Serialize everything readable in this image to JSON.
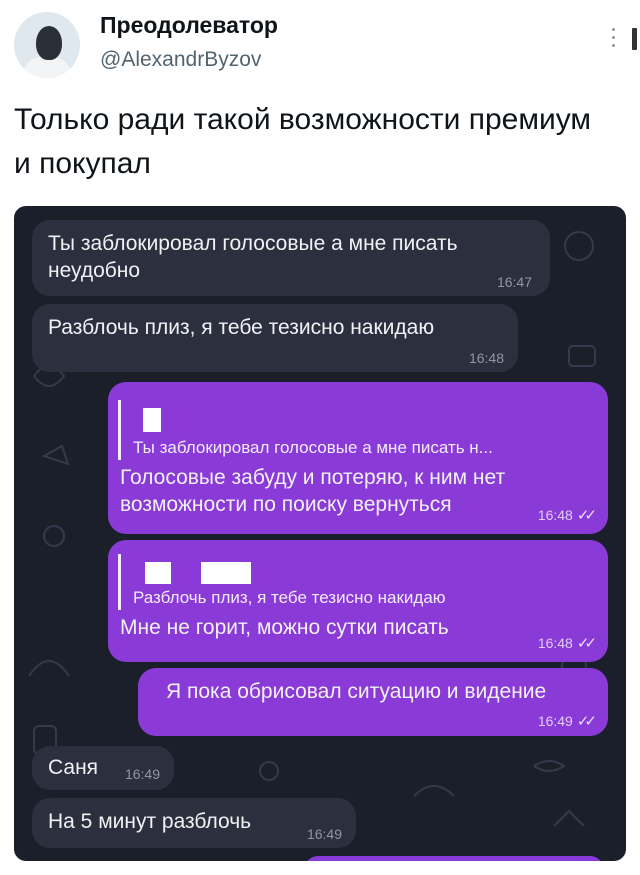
{
  "tweet": {
    "display_name": "Преодолеватор",
    "handle": "@AlexandrByzov",
    "text": "Только ради такой возможности премиум и покупал",
    "more_icon": "vertical-dots-icon"
  },
  "chat": {
    "background_color": "#1b1f2a",
    "incoming_color": "#2b2f3e",
    "outgoing_color": "#8a3ad6",
    "messages": [
      {
        "direction": "in",
        "text": "Ты заблокировал голосовые а мне писать\nнеудобно",
        "time": "16:47"
      },
      {
        "direction": "in",
        "text": "Разблочь плиз,  я тебе тезисно накидаю",
        "time": "16:48"
      },
      {
        "direction": "out",
        "reply_to": "Ты заблокировал голосовые а мне писать н...",
        "text": "Голосовые забуду и потеряю, к ним нет\nвозможности по поиску вернуться",
        "time": "16:48",
        "status": "read"
      },
      {
        "direction": "out",
        "reply_to": "Разблочь плиз,  я тебе тезисно накидаю",
        "text": "Мне не горит, можно сутки писать",
        "time": "16:48",
        "status": "read"
      },
      {
        "direction": "out",
        "text": "Я пока обрисовал ситуацию и видение",
        "time": "16:49",
        "status": "read"
      },
      {
        "direction": "in",
        "text": "Саня",
        "time": "16:49"
      },
      {
        "direction": "in",
        "text": "На 5 минут разблочь",
        "time": "16:49"
      }
    ],
    "read_ticks": "✓✓"
  }
}
